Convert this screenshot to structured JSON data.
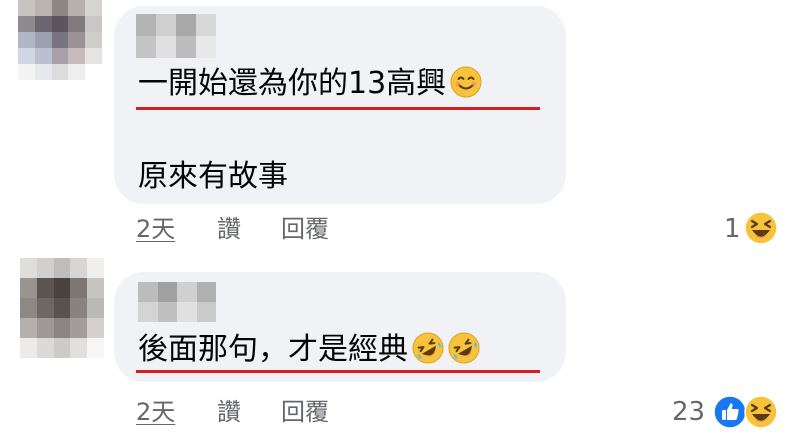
{
  "colors": {
    "bubble_bg": "#f0f2f5",
    "text": "#050505",
    "secondary_text": "#65676b",
    "underline": "#d62020",
    "like_blue": "#1877f2",
    "emoji_yellow": "#f7c33c"
  },
  "comments": [
    {
      "lines": [
        "一開始還為你的13高興",
        "原來有故事"
      ],
      "emojis": [
        "smiling-face-emoji"
      ],
      "actions": {
        "time": "2天",
        "like": "讚",
        "reply": "回覆"
      },
      "reactions": {
        "count": "1",
        "icons": [
          "laughing-face-icon"
        ]
      }
    },
    {
      "lines": [
        "後面那句，才是經典"
      ],
      "emojis": [
        "rolling-on-floor-laughing-emoji",
        "rolling-on-floor-laughing-emoji"
      ],
      "actions": {
        "time": "2天",
        "like": "讚",
        "reply": "回覆"
      },
      "reactions": {
        "count": "23",
        "icons": [
          "like-icon",
          "laughing-face-icon"
        ]
      }
    }
  ]
}
